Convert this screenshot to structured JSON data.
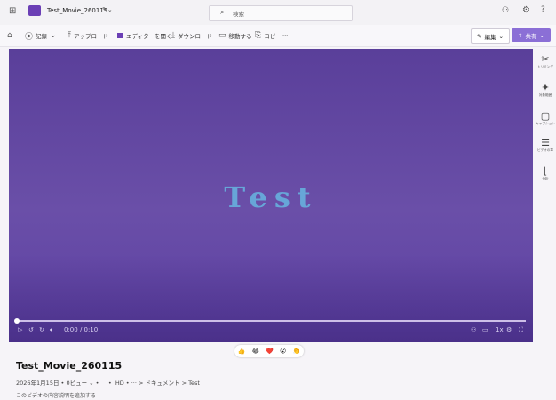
{
  "app": {
    "file_name": "Test_Movie_260115",
    "search_placeholder": "検索",
    "top_icons": [
      "waffle-icon",
      "clapperboard-icon",
      "user-share-icon",
      "settings-icon",
      "help-icon"
    ]
  },
  "toolbar": {
    "record_label": "記録",
    "upload_label": "アップロード",
    "open_editor_label": "エディターを開く",
    "download_label": "ダウンロード",
    "move_label": "移動する",
    "copy_label": "コピー",
    "more_label": "···",
    "edit_label": "編集",
    "share_label": "共有"
  },
  "video": {
    "title_text": "Test",
    "time_display": "0:00 / 0:10",
    "speed_label": "1x",
    "progress_fraction": 0.0
  },
  "rail": {
    "items": [
      {
        "label": "トリミング",
        "icon": "scissors-icon"
      },
      {
        "label": "対象範囲",
        "icon": "sparkle-icon"
      },
      {
        "label": "キャプション",
        "icon": "caption-icon"
      },
      {
        "label": "ビデオの章",
        "icon": "chapters-icon"
      },
      {
        "label": "分析",
        "icon": "chart-icon"
      }
    ]
  },
  "reactions": [
    "👍",
    "😂",
    "❤️",
    "😮",
    "👏"
  ],
  "meta": {
    "title": "Test_Movie_260115",
    "date": "2026年1月15日",
    "views": "0ビュー",
    "quality": "HD",
    "breadcrumb": [
      "···",
      "ドキュメント",
      "Test"
    ],
    "description_placeholder": "このビデオの内容説明を追加する"
  },
  "colors": {
    "video_bg": "#5a3f9a",
    "title_color": "#67a6d8",
    "share_button": "#8b6fd6"
  }
}
